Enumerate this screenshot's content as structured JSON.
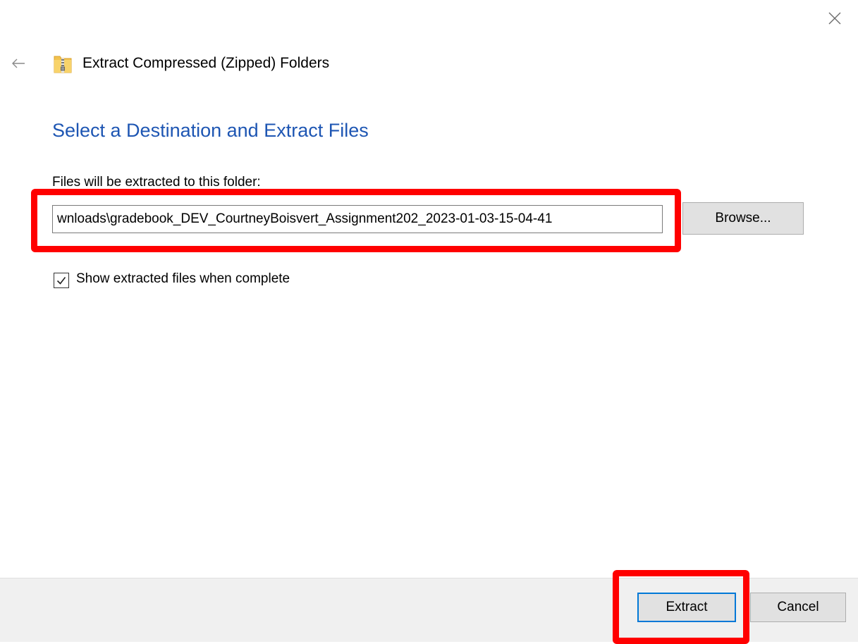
{
  "window": {
    "title": "Extract Compressed (Zipped) Folders"
  },
  "main": {
    "heading": "Select a Destination and Extract Files",
    "folder_label": "Files will be extracted to this folder:",
    "destination_path": "wnloads\\gradebook_DEV_CourtneyBoisvert_Assignment202_2023-01-03-15-04-41",
    "browse_label": "Browse...",
    "show_files_label": "Show extracted files when complete",
    "show_files_checked": true
  },
  "footer": {
    "extract_label": "Extract",
    "cancel_label": "Cancel"
  },
  "colors": {
    "heading": "#1e56b3",
    "highlight": "#ff0000",
    "focus_border": "#0078d7"
  },
  "icons": {
    "close": "close-icon",
    "back": "back-arrow-icon",
    "zip": "zip-folder-icon",
    "check": "checkmark-icon"
  }
}
